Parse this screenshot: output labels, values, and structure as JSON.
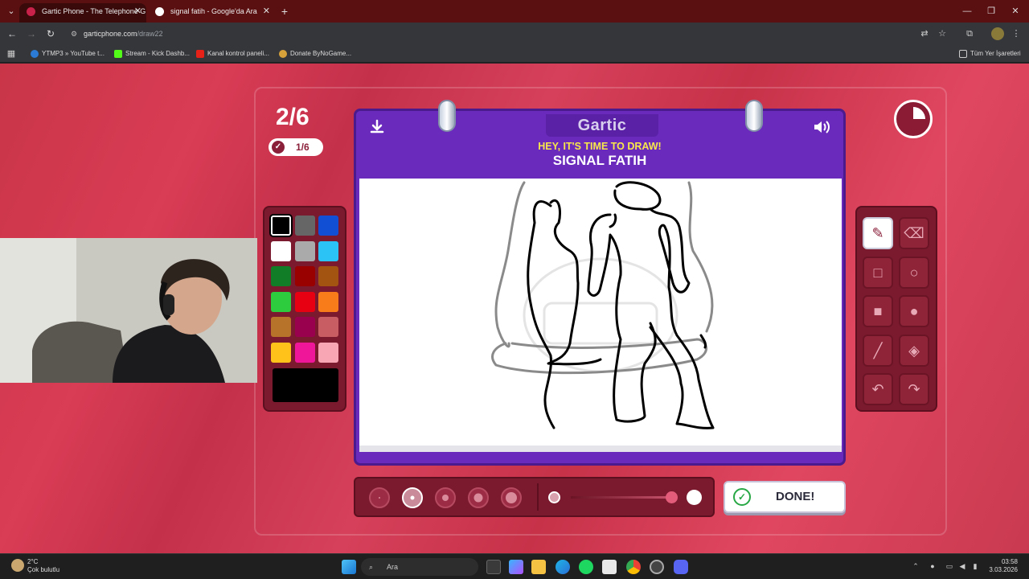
{
  "browser": {
    "tabs": [
      {
        "title": "Gartic Phone - The Telephone G",
        "active": true
      },
      {
        "title": "signal fatih - Google'da Ara",
        "active": false
      }
    ],
    "url": "garticphone.com",
    "url_path": "/draw22",
    "bookmarks": [
      "YTMP3 » YouTube t...",
      "Stream - Kick Dashb...",
      "Kanal kontrol paneli...",
      "Donate ByNoGame..."
    ],
    "all_bookmarks": "Tüm Yer İşaretleri"
  },
  "game": {
    "round": "2/6",
    "players_done": "1/6",
    "logo": "Gartic",
    "prompt_label": "HEY, IT'S TIME TO DRAW!",
    "word": "SIGNAL FATIH",
    "done_label": "DONE!",
    "timer_remaining_fraction": 0.75,
    "palette": [
      "#000000",
      "#666666",
      "#1150d4",
      "#ffffff",
      "#aaaaaa",
      "#2bc2f5",
      "#127d27",
      "#990000",
      "#a35410",
      "#2dcc3f",
      "#e60012",
      "#f97c1a",
      "#b8732b",
      "#99004d",
      "#c95d64",
      "#ffc21b",
      "#f0169a",
      "#f9a6b4"
    ],
    "selected_color": "#000000",
    "brush_sizes": 5,
    "selected_brush_index": 1,
    "tools": [
      "pen-icon",
      "eraser-icon",
      "rectangle-icon",
      "ellipse-icon",
      "filled-rectangle-icon",
      "filled-ellipse-icon",
      "line-icon",
      "fill-bucket-icon",
      "undo-icon",
      "redo-icon"
    ]
  },
  "taskbar": {
    "weather_temp": "2°C",
    "weather_desc": "Çok bulutlu",
    "search": "Ara",
    "time": "03:58",
    "date": "3.03.2026"
  }
}
